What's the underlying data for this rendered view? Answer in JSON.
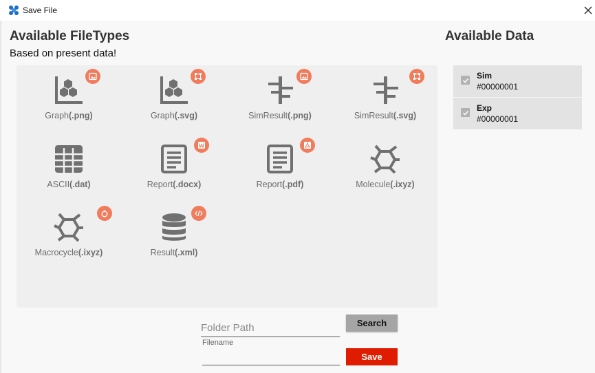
{
  "window": {
    "title": "Save File"
  },
  "filetypes": {
    "heading": "Available FileTypes",
    "subheading": "Based on present data!",
    "items": [
      {
        "name": "Graph",
        "ext": "(.png)",
        "icon": "graph-icon",
        "badge": "image-icon"
      },
      {
        "name": "Graph",
        "ext": "(.svg)",
        "icon": "graph-icon",
        "badge": "vector-icon"
      },
      {
        "name": "SimResult",
        "ext": "(.png)",
        "icon": "simresult-icon",
        "badge": "image-icon"
      },
      {
        "name": "SimResult",
        "ext": "(.svg)",
        "icon": "simresult-icon",
        "badge": "vector-icon"
      },
      {
        "name": "ASCII",
        "ext": "(.dat)",
        "icon": "table-icon",
        "badge": ""
      },
      {
        "name": "Report",
        "ext": "(.docx)",
        "icon": "document-icon",
        "badge": "word-icon"
      },
      {
        "name": "Report",
        "ext": "(.pdf)",
        "icon": "document-icon",
        "badge": "pdf-icon"
      },
      {
        "name": "Molecule",
        "ext": "(.ixyz)",
        "icon": "molecule-icon",
        "badge": ""
      },
      {
        "name": "Macrocycle",
        "ext": "(.ixyz)",
        "icon": "molecule-icon",
        "badge": "ring-icon"
      },
      {
        "name": "Result",
        "ext": "(.xml)",
        "icon": "database-icon",
        "badge": "code-icon"
      }
    ]
  },
  "data": {
    "heading": "Available Data",
    "items": [
      {
        "name": "Sim",
        "id": "#00000001",
        "checked": true
      },
      {
        "name": "Exp",
        "id": "#00000001",
        "checked": true
      }
    ]
  },
  "form": {
    "folder_placeholder": "Folder Path",
    "filename_label": "Filename",
    "search_label": "Search",
    "save_label": "Save"
  },
  "colors": {
    "badge": "#f07c5c",
    "icon": "#707070",
    "save": "#e01c00",
    "search": "#a5a5a5"
  }
}
